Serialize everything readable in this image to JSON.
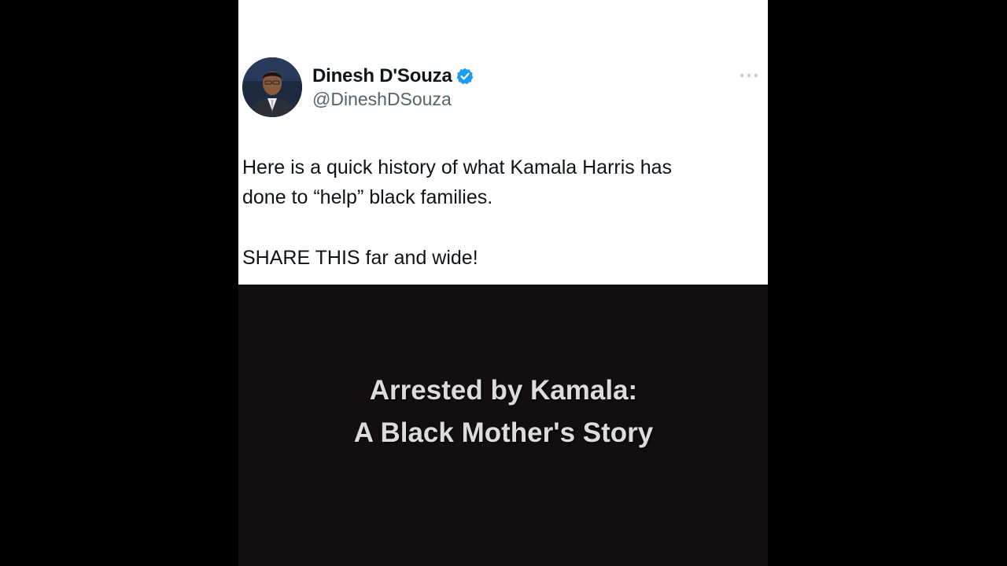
{
  "author": {
    "display_name": "Dinesh D'Souza",
    "handle": "@DineshDSouza",
    "verified": true,
    "avatar_icon": "profile-photo"
  },
  "tweet": {
    "text_lines": [
      "Here is a quick history of what Kamala Harris has",
      "done to “help” black families."
    ],
    "text_line2": "SHARE THIS far and wide!"
  },
  "video": {
    "title_line1": "Arrested by Kamala:",
    "title_line2": "A Black Mother's Story"
  },
  "colors": {
    "background": "#000000",
    "card": "#ffffff",
    "verified_badge": "#1d9bf0",
    "handle_text": "#536471",
    "video_bg": "#140e0e"
  },
  "icons": {
    "more": "more-horizontal-icon",
    "verified": "verified-badge-icon"
  }
}
